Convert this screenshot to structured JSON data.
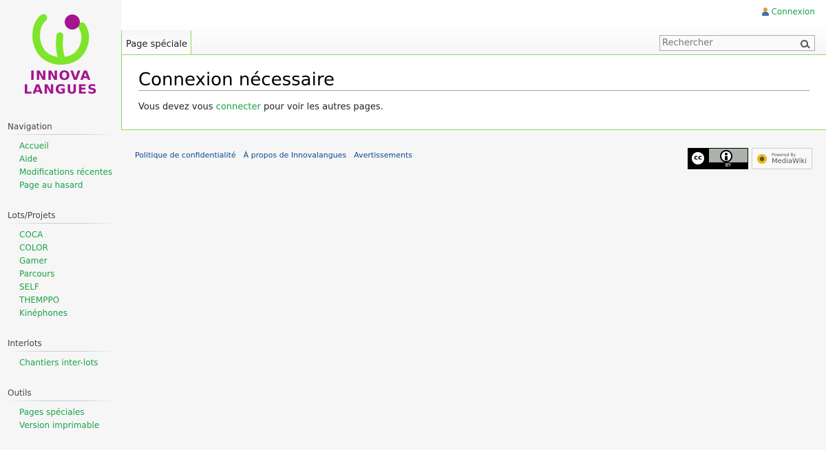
{
  "personal": {
    "login_label": "Connexion"
  },
  "logo": {
    "line1": "INNOVA",
    "line2": "LANGUES"
  },
  "tabs": [
    {
      "label": "Page spéciale"
    }
  ],
  "search": {
    "placeholder": "Rechercher"
  },
  "content": {
    "title": "Connexion nécessaire",
    "text_before": "Vous devez vous ",
    "link": "connecter",
    "text_after": " pour voir les autres pages."
  },
  "sidebar": {
    "navigation": {
      "heading": "Navigation",
      "items": [
        "Accueil",
        "Aide",
        "Modifications récentes",
        "Page au hasard"
      ]
    },
    "lots": {
      "heading": "Lots/Projets",
      "items": [
        "COCA",
        "COLOR",
        "Gamer",
        "Parcours",
        "SELF",
        "THEMPPO",
        "Kinéphones"
      ]
    },
    "interlots": {
      "heading": "Interlots",
      "items": [
        "Chantiers inter-lots"
      ]
    },
    "outils": {
      "heading": "Outils",
      "items": [
        "Pages spéciales",
        "Version imprimable"
      ]
    }
  },
  "footer": {
    "links": [
      "Politique de confidentialité",
      "À propos de Innovalangues",
      "Avertissements"
    ],
    "cc_badge": {
      "circle": "cc",
      "label": "BY"
    },
    "mediawiki_badge": {
      "small": "Powered By",
      "big": "MediaWiki"
    }
  },
  "colors": {
    "link_green": "#1aa346",
    "footer_link": "#0b4a8f",
    "logo_purple": "#a4148f",
    "logo_green": "#7ee52a",
    "border_green": "#8fd95f"
  }
}
